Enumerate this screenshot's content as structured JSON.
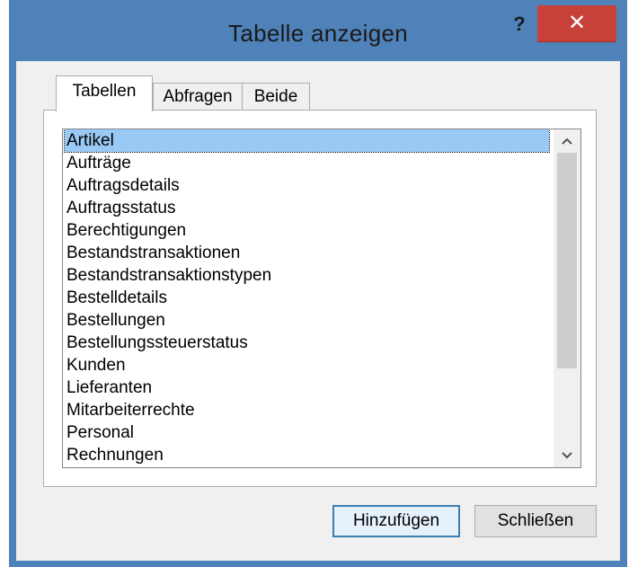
{
  "window": {
    "title": "Tabelle anzeigen",
    "help_label": "?",
    "close_label": "✕"
  },
  "tabs": [
    {
      "label": "Tabellen",
      "active": true
    },
    {
      "label": "Abfragen",
      "active": false
    },
    {
      "label": "Beide",
      "active": false
    }
  ],
  "list": {
    "items": [
      "Artikel",
      "Aufträge",
      "Auftragsdetails",
      "Auftragsstatus",
      "Berechtigungen",
      "Bestandstransaktionen",
      "Bestandstransaktionstypen",
      "Bestelldetails",
      "Bestellungen",
      "Bestellungssteuerstatus",
      "Kunden",
      "Lieferanten",
      "Mitarbeiterrechte",
      "Personal",
      "Rechnungen"
    ],
    "selected": "Artikel"
  },
  "scrollbar": {
    "up_icon": "chevron-up-icon",
    "down_icon": "chevron-down-icon"
  },
  "buttons": {
    "add_label": "Hinzufügen",
    "close_label": "Schließen"
  },
  "colors": {
    "window_frame": "#4f82b8",
    "close_button": "#c7403a",
    "selection": "#99c9f5",
    "default_button_border": "#3c7fb1"
  }
}
